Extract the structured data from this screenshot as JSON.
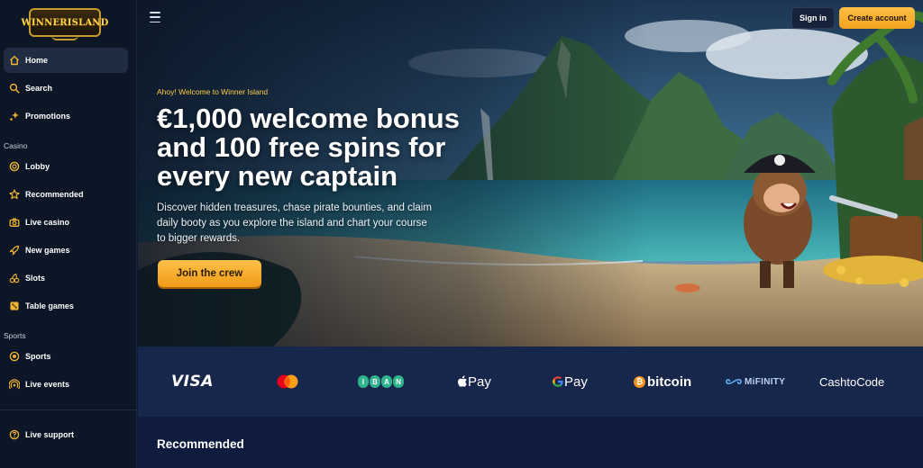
{
  "brand": {
    "logo_text": "WINNERISLAND"
  },
  "header": {
    "sign_in": "Sign in",
    "create_account": "Create account"
  },
  "sidebar": {
    "main": [
      {
        "label": "Home",
        "icon": "home-icon"
      },
      {
        "label": "Search",
        "icon": "search-icon"
      },
      {
        "label": "Promotions",
        "icon": "sparkle-icon"
      }
    ],
    "casino_heading": "Casino",
    "casino": [
      {
        "label": "Lobby",
        "icon": "chip-icon"
      },
      {
        "label": "Recommended",
        "icon": "star-icon"
      },
      {
        "label": "Live casino",
        "icon": "camera-icon"
      },
      {
        "label": "New games",
        "icon": "rocket-icon"
      },
      {
        "label": "Slots",
        "icon": "cherry-icon"
      },
      {
        "label": "Table games",
        "icon": "dice-icon"
      }
    ],
    "sports_heading": "Sports",
    "sports": [
      {
        "label": "Sports",
        "icon": "football-icon"
      },
      {
        "label": "Live events",
        "icon": "broadcast-icon"
      }
    ],
    "support": {
      "label": "Live support",
      "icon": "help-icon"
    }
  },
  "hero": {
    "eyebrow": "Ahoy! Welcome to Winner Island",
    "headline": "€1,000 welcome bonus and 100 free spins for every new captain",
    "subtext": "Discover hidden treasures, chase pirate bounties, and claim daily booty as you explore the island and chart your course to bigger rewards.",
    "cta": "Join the crew"
  },
  "payments": {
    "visa": "VISA",
    "iban": [
      "I",
      "B",
      "A",
      "N"
    ],
    "apple_pay": "Pay",
    "google_pay": "Pay",
    "bitcoin": "bitcoin",
    "mifinity": "MiFINITY",
    "cashtocode": "CashtoCode"
  },
  "recommended": {
    "title": "Recommended"
  }
}
